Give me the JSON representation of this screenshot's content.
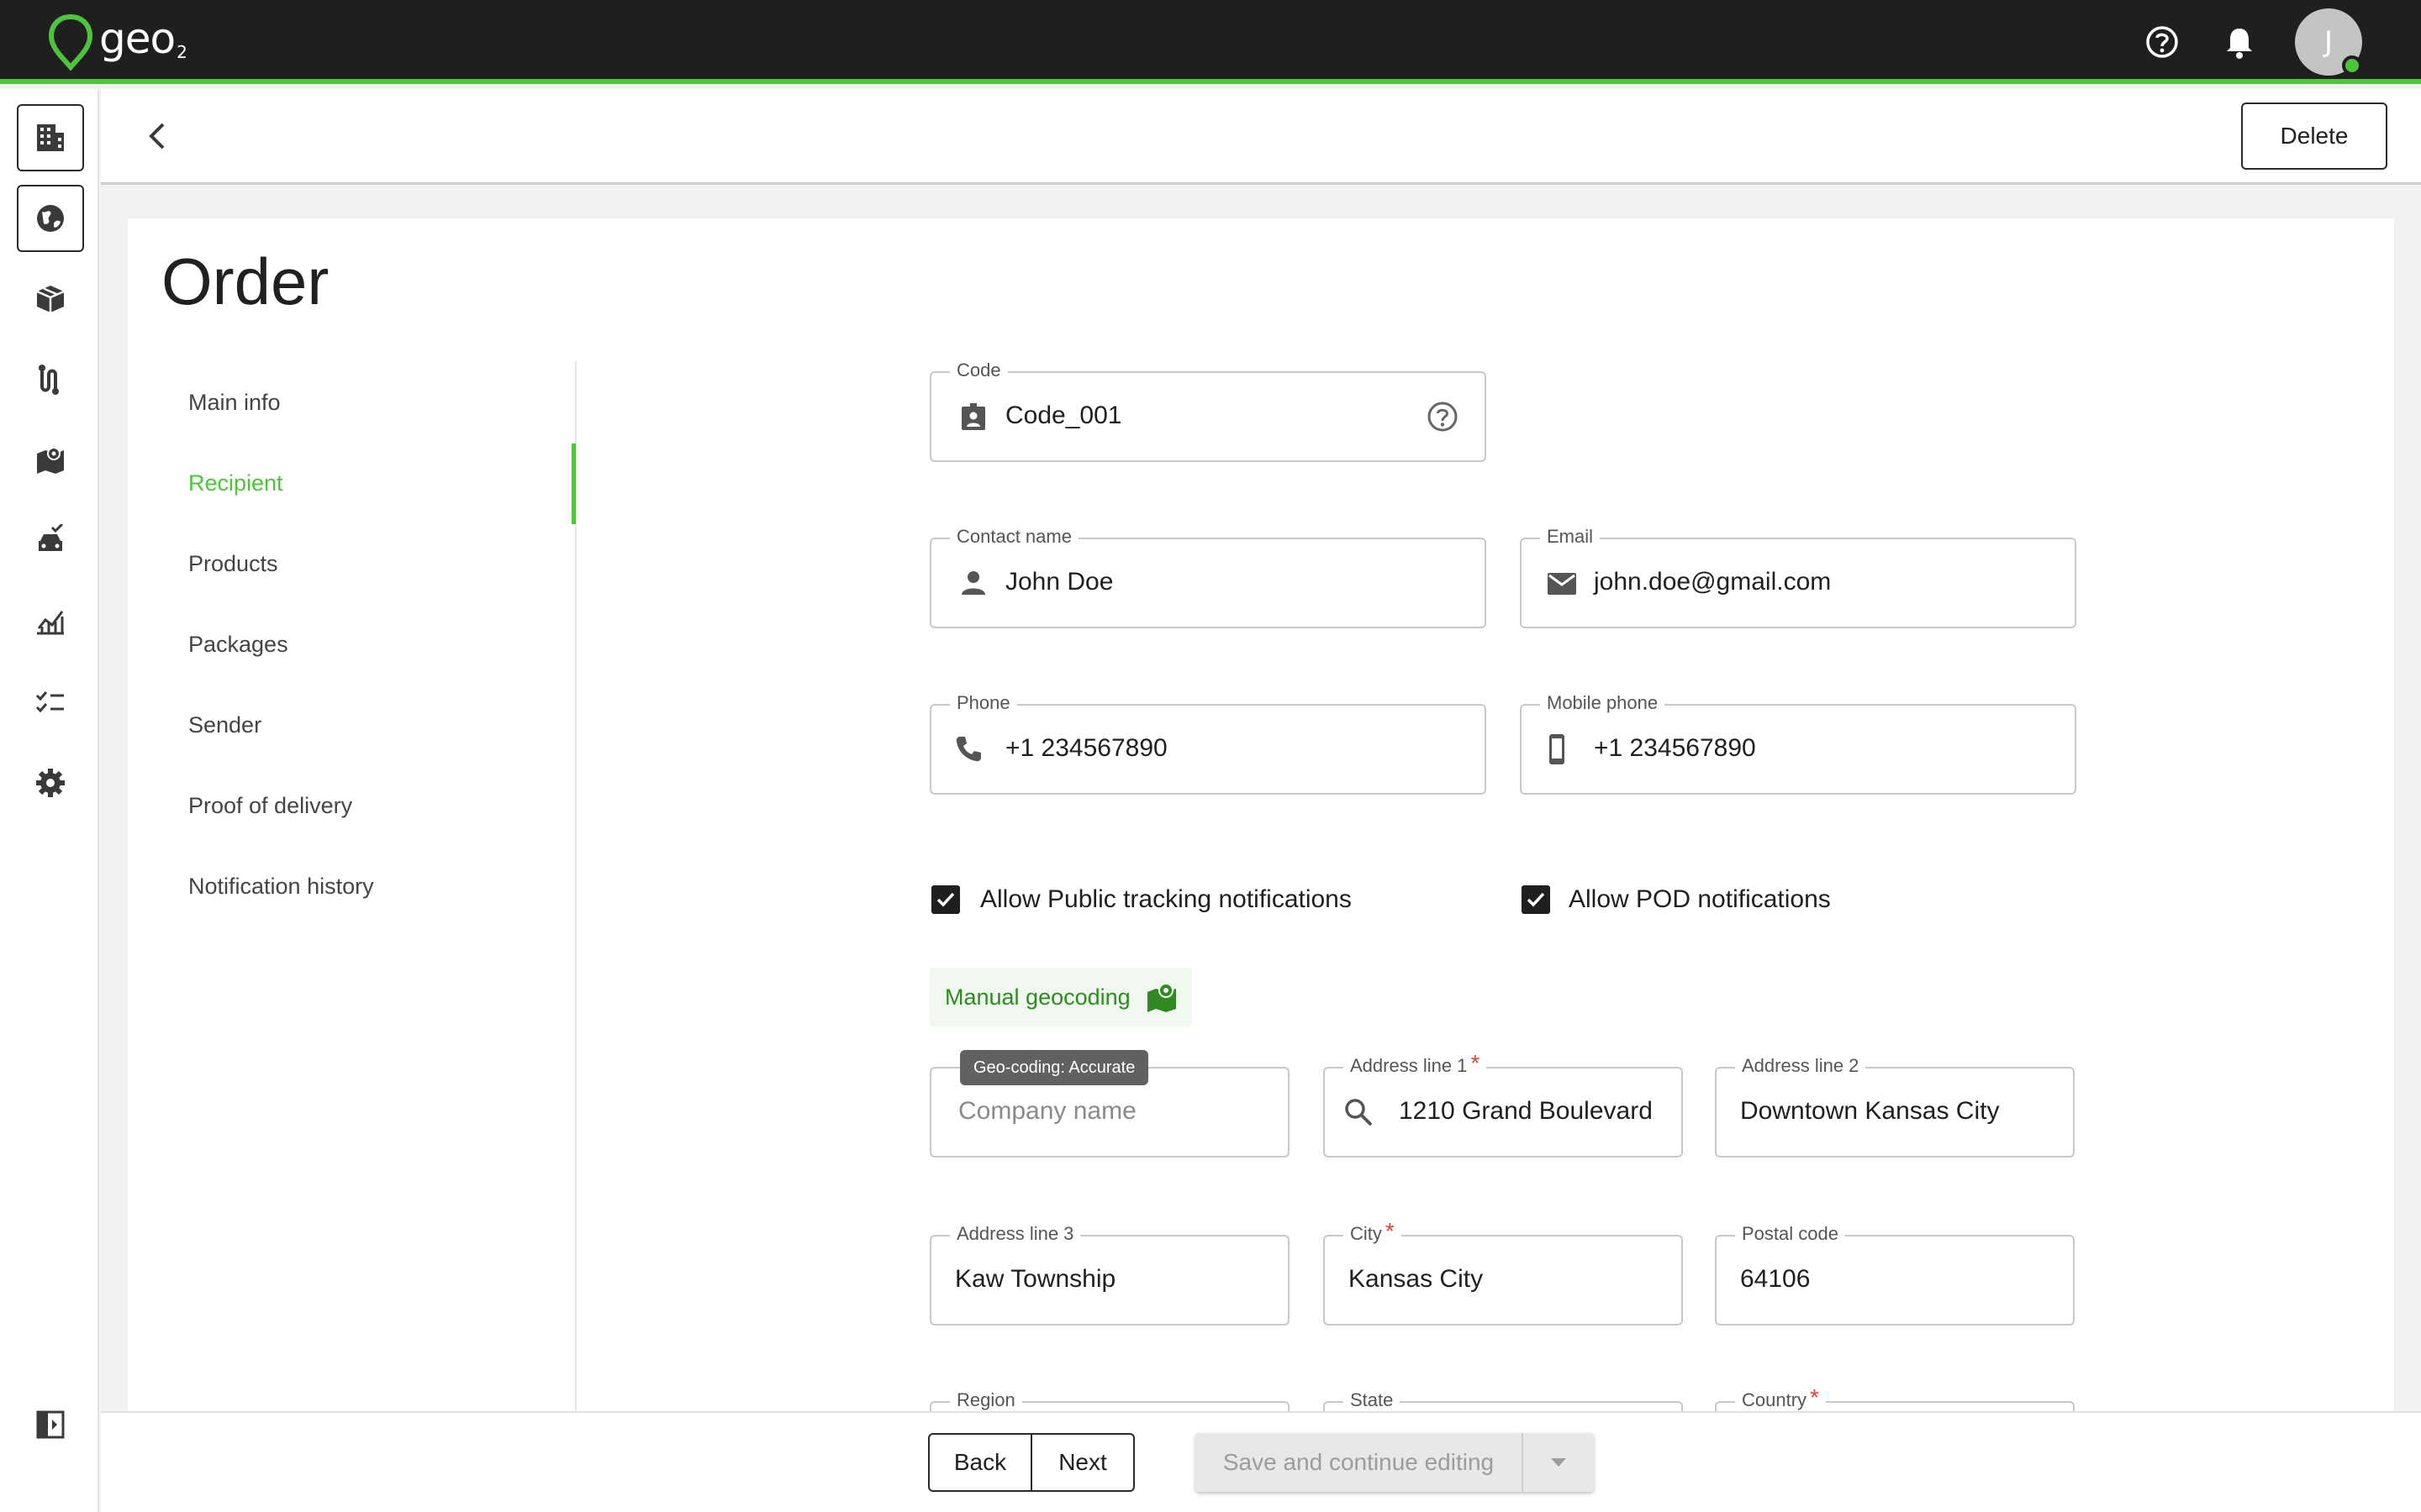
{
  "app": {
    "logo_text": "geo",
    "logo_sub": "2",
    "avatar_initial": "J",
    "accent_color": "#4ec43c"
  },
  "topbar": {
    "icons": [
      "help-icon",
      "bell-icon"
    ]
  },
  "rail": {
    "items": [
      "building-icon",
      "globe-icon",
      "box-icon",
      "route-icon",
      "map-icon",
      "vehicle-icon",
      "analytics-icon",
      "checklist-icon",
      "gear-icon"
    ],
    "bottom_icon": "collapse-sidebar-icon"
  },
  "header": {
    "delete_label": "Delete"
  },
  "page": {
    "title": "Order"
  },
  "tabs": [
    {
      "label": "Main info",
      "active": false
    },
    {
      "label": "Recipient",
      "active": true
    },
    {
      "label": "Products",
      "active": false
    },
    {
      "label": "Packages",
      "active": false
    },
    {
      "label": "Sender",
      "active": false
    },
    {
      "label": "Proof of delivery",
      "active": false
    },
    {
      "label": "Notification history",
      "active": false
    }
  ],
  "form": {
    "code": {
      "label": "Code",
      "value": "Code_001"
    },
    "contact_name": {
      "label": "Contact name",
      "value": "John Doe"
    },
    "email": {
      "label": "Email",
      "value": "john.doe@gmail.com"
    },
    "phone": {
      "label": "Phone",
      "value": "+1 234567890"
    },
    "mobile_phone": {
      "label": "Mobile phone",
      "value": "+1 234567890"
    },
    "allow_public_tracking": {
      "label": "Allow Public tracking notifications",
      "checked": true
    },
    "allow_pod": {
      "label": "Allow POD notifications",
      "checked": true
    },
    "manual_geocoding_label": "Manual geocoding",
    "geocoding_tooltip": "Geo-coding: Accurate",
    "company_name": {
      "label": "",
      "placeholder": "Company name",
      "value": ""
    },
    "address_line_1": {
      "label": "Address line 1",
      "value": "1210 Grand Boulevard",
      "required": "*"
    },
    "address_line_2": {
      "label": "Address line 2",
      "value": "Downtown Kansas City"
    },
    "address_line_3": {
      "label": "Address line 3",
      "value": "Kaw Township"
    },
    "city": {
      "label": "City",
      "value": "Kansas City",
      "required": "*"
    },
    "postal_code": {
      "label": "Postal code",
      "value": "64106"
    },
    "region": {
      "label": "Region"
    },
    "state": {
      "label": "State"
    },
    "country": {
      "label": "Country",
      "required": "*"
    }
  },
  "footer": {
    "back_label": "Back",
    "next_label": "Next",
    "save_label": "Save and continue editing"
  }
}
